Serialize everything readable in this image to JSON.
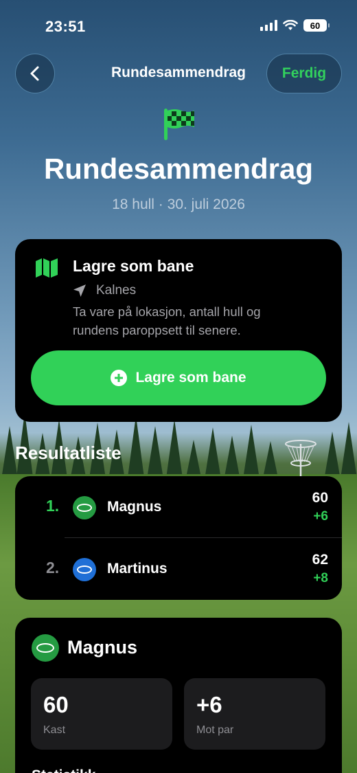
{
  "status_bar": {
    "time": "23:51",
    "battery": "60"
  },
  "nav": {
    "title": "Rundesammendrag",
    "done_label": "Ferdig"
  },
  "header": {
    "title": "Rundesammendrag",
    "subtitle": "18 hull · 30. juli 2026"
  },
  "save_course": {
    "title": "Lagre som bane",
    "location": "Kalnes",
    "description": "Ta vare på lokasjon, antall hull og rundens paroppsett til senere.",
    "button_label": "Lagre som bane"
  },
  "results": {
    "heading": "Resultatliste",
    "rows": [
      {
        "rank": "1.",
        "name": "Magnus",
        "score": "60",
        "diff": "+6"
      },
      {
        "rank": "2.",
        "name": "Martinus",
        "score": "62",
        "diff": "+8"
      }
    ]
  },
  "player_detail": {
    "name": "Magnus",
    "stats": [
      {
        "value": "60",
        "label": "Kast"
      },
      {
        "value": "+6",
        "label": "Mot par"
      }
    ],
    "section_heading": "Statistikk"
  },
  "colors": {
    "accent": "#31d158",
    "card": "#000000",
    "player1": "#259b42",
    "player2": "#1f6fd6"
  }
}
